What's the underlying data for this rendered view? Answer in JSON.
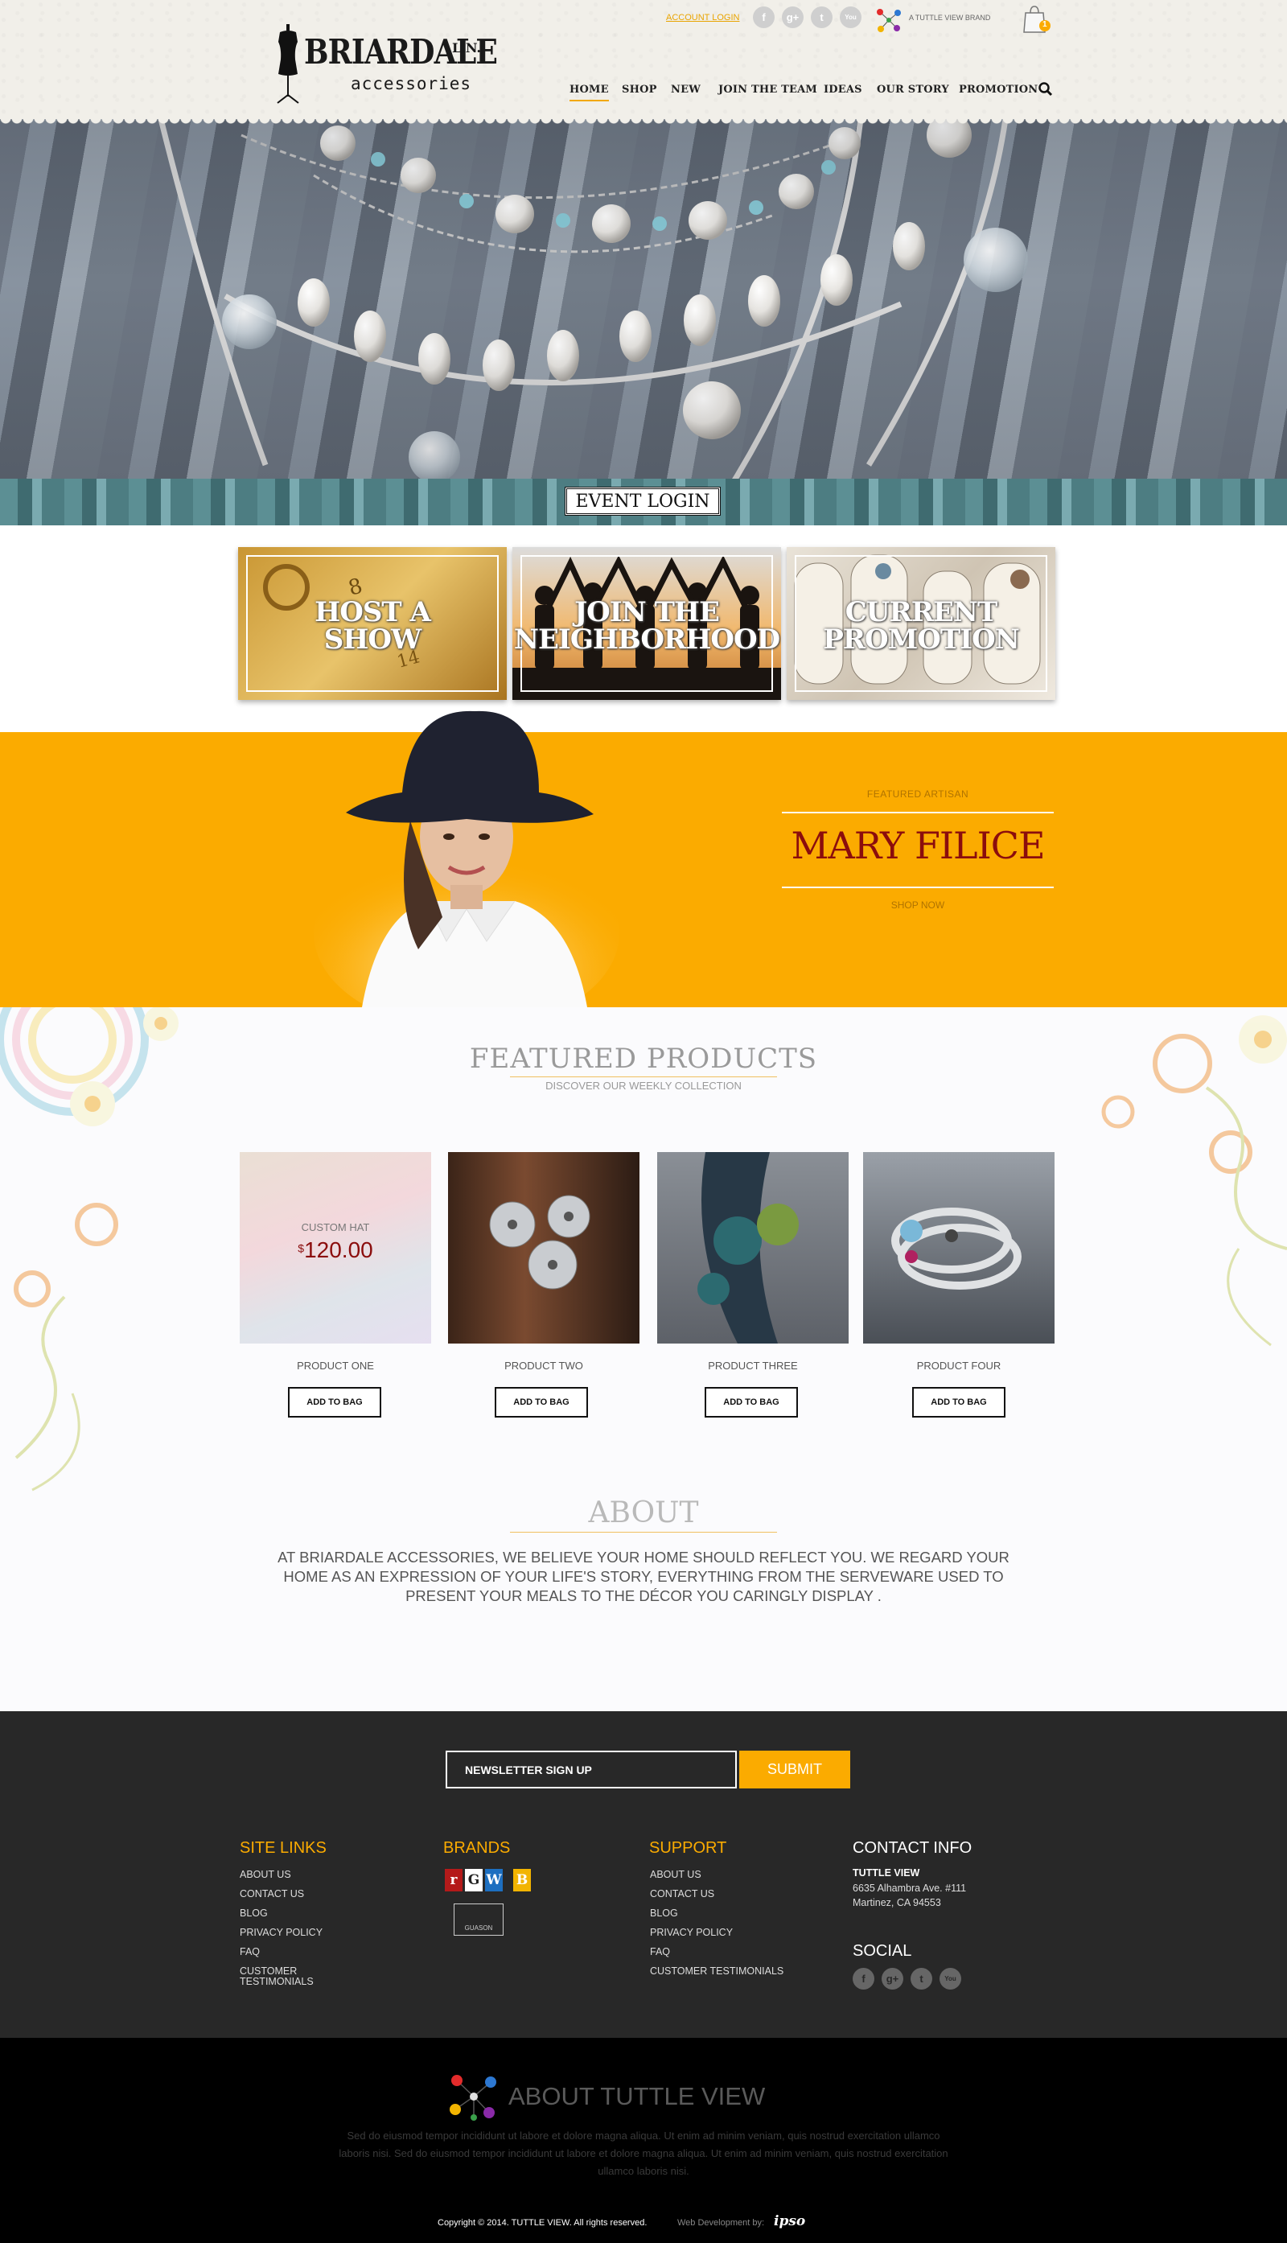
{
  "header": {
    "brand": "BRIARDALE",
    "brand_suffix": "L.N.",
    "brand_sub": "accessories",
    "account_login": "ACCOUNT LOGIN",
    "tuttle_brand": "A TUTTLE VIEW BRAND",
    "cart_count": "1",
    "social": [
      "f",
      "g+",
      "t",
      "You"
    ],
    "nav": [
      "HOME",
      "SHOP",
      "NEW",
      "JOIN THE TEAM",
      "IDEAS",
      "OUR STORY",
      "PROMOTION"
    ],
    "active_nav": "HOME"
  },
  "hero": {
    "event_login": "EVENT LOGIN"
  },
  "tiles": [
    {
      "line1": "HOST A",
      "line2": "SHOW"
    },
    {
      "line1": "JOIN THE",
      "line2": "NEIGHBORHOOD"
    },
    {
      "line1": "CURRENT",
      "line2": "PROMOTION"
    }
  ],
  "featured_artisan": {
    "label": "FEATURED ARTISAN",
    "name": "MARY FILICE",
    "shop_now": "SHOP NOW"
  },
  "featured_products": {
    "title": "FEATURED PRODUCTS",
    "subtitle": "DISCOVER OUR WEEKLY COLLECTION",
    "items": [
      {
        "name": "PRODUCT ONE",
        "overlay_label": "CUSTOM HAT",
        "overlay_currency": "$",
        "overlay_price": "120.00",
        "button": "ADD TO BAG"
      },
      {
        "name": "PRODUCT TWO",
        "button": "ADD TO BAG"
      },
      {
        "name": "PRODUCT THREE",
        "button": "ADD TO BAG"
      },
      {
        "name": "PRODUCT FOUR",
        "button": "ADD TO BAG"
      }
    ]
  },
  "about": {
    "title": "ABOUT",
    "text": "AT BRIARDALE ACCESSORIES, WE BELIEVE YOUR HOME SHOULD REFLECT  YOU. WE REGARD  YOUR HOME AS AN EXPRESSION OF YOUR LIFE'S STORY, EVERYTHING FROM THE SERVEWARE USED TO PRESENT YOUR MEALS TO THE DÉCOR YOU CARINGLY DISPLAY ."
  },
  "footer": {
    "newsletter_placeholder": "NEWSLETTER SIGN UP",
    "submit": "SUBMIT",
    "site_links": {
      "heading": "SITE LINKS",
      "items": [
        "ABOUT US",
        "CONTACT US",
        "BLOG",
        "PRIVACY POLICY",
        "FAQ",
        "CUSTOMER",
        "TESTIMONIALS"
      ]
    },
    "brands": {
      "heading": "BRANDS",
      "letters": [
        "r",
        "G",
        "W",
        "B"
      ],
      "colors": [
        "#b41a1a",
        "#ffffff",
        "#1d6fc0",
        "#f2b400"
      ],
      "extra_logo": "GUASON"
    },
    "support": {
      "heading": "SUPPORT",
      "items": [
        "ABOUT US",
        "CONTACT US",
        "BLOG",
        "PRIVACY POLICY",
        "FAQ",
        "CUSTOMER TESTIMONIALS"
      ]
    },
    "contact": {
      "heading": "CONTACT INFO",
      "company": "TUTTLE VIEW",
      "address1": "6635 Alhambra Ave. #111",
      "address2": "Martinez, CA 94553"
    },
    "social": {
      "heading": "SOCIAL",
      "icons": [
        "f",
        "g+",
        "t",
        "You"
      ]
    }
  },
  "bottom": {
    "title": "ABOUT TUTTLE VIEW",
    "text": "Sed do eiusmod tempor incididunt ut labore et dolore magna aliqua. Ut enim ad minim veniam, quis nostrud exercitation ullamco laboris nisi. Sed do eiusmod tempor incididunt ut labore et dolore magna aliqua. Ut enim ad minim veniam, quis nostrud exercitation ullamco laboris nisi.",
    "copyright": "Copyright © 2014. TUTTLE VIEW. All rights reserved.",
    "web_dev": "Web Development by:",
    "developer": "ipso"
  },
  "colors": {
    "accent": "#fbab00",
    "artisan_name": "#8b0d0d",
    "footer_bg": "#282828",
    "bottom_bg": "#000000"
  }
}
